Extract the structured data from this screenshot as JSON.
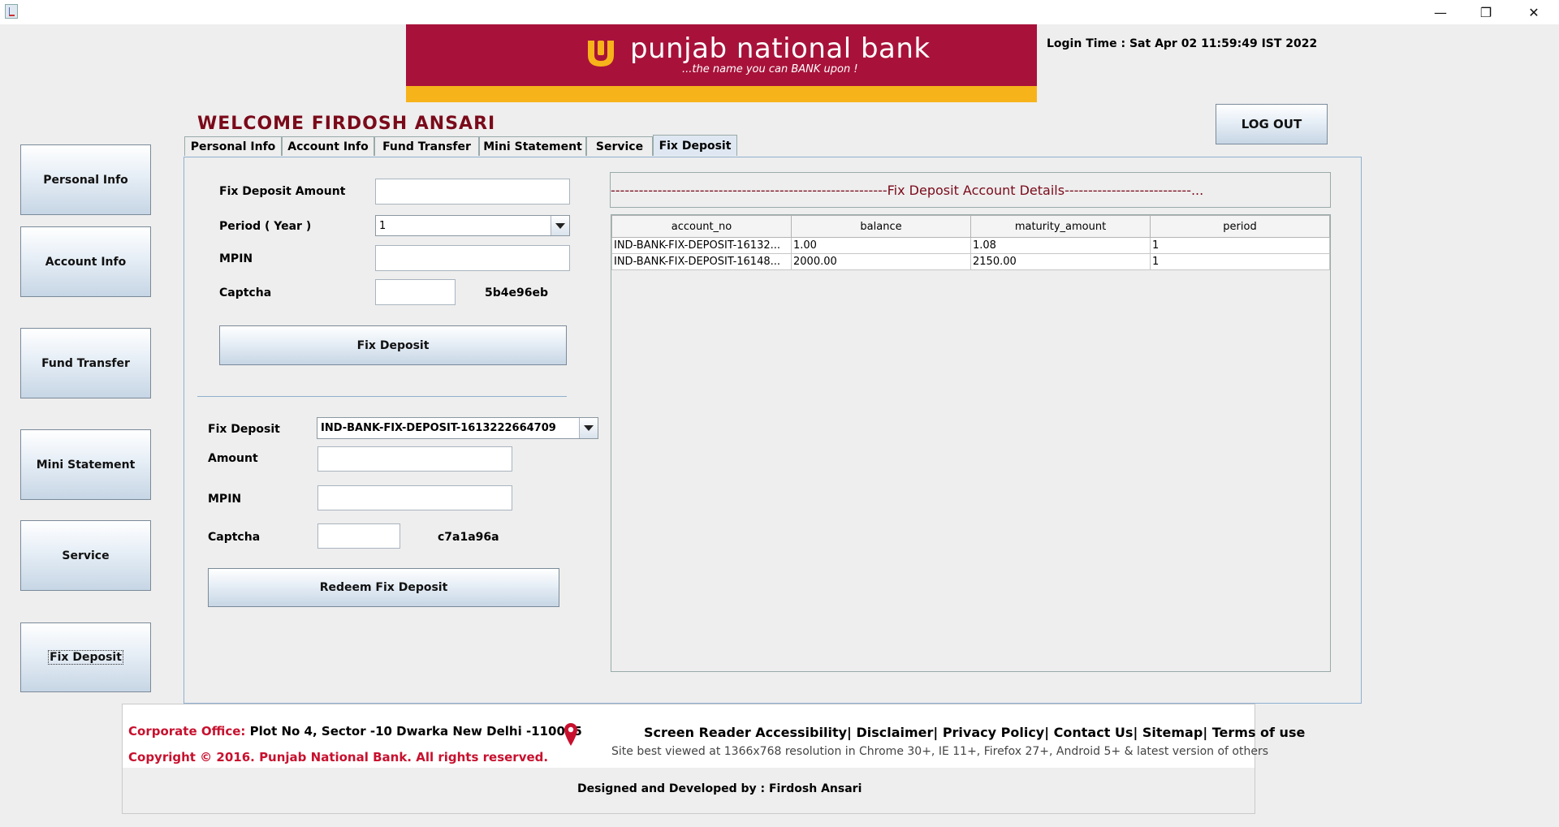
{
  "window": {
    "minimize_glyph": "—",
    "restore_glyph": "❐",
    "close_glyph": "✕"
  },
  "header": {
    "brand_name": "punjab national bank",
    "tagline": "...the name you can BANK upon !",
    "login_time": "Login Time : Sat Apr 02 11:59:49 IST 2022",
    "logout_label": "LOG OUT",
    "welcome": "WELCOME FIRDOSH  ANSARI",
    "colors": {
      "brand_red": "#a8123a",
      "brand_gold": "#f7b31a"
    }
  },
  "sidebar": {
    "items": [
      {
        "label": "Personal Info"
      },
      {
        "label": "Account Info"
      },
      {
        "label": "Fund Transfer"
      },
      {
        "label": "Mini Statement"
      },
      {
        "label": "Service"
      },
      {
        "label": "Fix Deposit"
      }
    ],
    "selected": "Fix Deposit"
  },
  "tabs": {
    "items": [
      {
        "label": "Personal Info"
      },
      {
        "label": "Account Info"
      },
      {
        "label": "Fund Transfer"
      },
      {
        "label": "Mini Statement"
      },
      {
        "label": "Service"
      },
      {
        "label": "Fix Deposit"
      }
    ],
    "active": "Fix Deposit"
  },
  "create_form": {
    "amount_label": "Fix Deposit Amount",
    "amount_value": "",
    "period_label": "Period ( Year )",
    "period_value": "1",
    "mpin_label": "MPIN",
    "mpin_value": "",
    "captcha_label": "Captcha",
    "captcha_value": "",
    "captcha_code": "5b4e96eb",
    "submit_label": "Fix Deposit"
  },
  "redeem_form": {
    "deposit_label": "Fix Deposit",
    "deposit_value": "IND-BANK-FIX-DEPOSIT-1613222664709",
    "amount_label": "Amount",
    "amount_value": "",
    "mpin_label": "MPIN",
    "mpin_value": "",
    "captcha_label": "Captcha",
    "captcha_value": "",
    "captcha_code": "c7a1a96a",
    "submit_label": "Redeem Fix Deposit"
  },
  "details": {
    "title": "-----------------------------------------------------------Fix Deposit Account Details---------------------------...",
    "columns": [
      "account_no",
      "balance",
      "maturity_amount",
      "period"
    ],
    "rows": [
      [
        "IND-BANK-FIX-DEPOSIT-16132...",
        "1.00",
        "1.08",
        "1"
      ],
      [
        "IND-BANK-FIX-DEPOSIT-16148...",
        "2000.00",
        "2150.00",
        "1"
      ]
    ]
  },
  "footer": {
    "corp_label": "Corporate Office:",
    "corp_address": "Plot No 4, Sector -10 Dwarka New Delhi -110075",
    "copyright": "Copyright © 2016. Punjab National Bank. All rights reserved.",
    "links": [
      "Screen Reader Accessibility",
      "Disclaimer",
      "Privacy Policy",
      "Contact Us",
      "Sitemap",
      "Terms of use"
    ],
    "best_view": "Site best viewed at 1366x768 resolution in Chrome 30+, IE 11+, Firefox 27+, Android 5+ & latest version of others",
    "credit": "Designed and Developed by : Firdosh Ansari"
  }
}
